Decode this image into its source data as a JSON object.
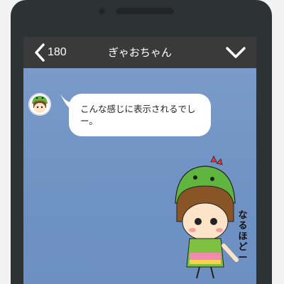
{
  "header": {
    "back_count": "180",
    "title": "ぎゃおちゃん"
  },
  "messages": [
    {
      "text": "こんな感じに表示されるでしー。"
    }
  ],
  "sticker": {
    "caption": "なるほどー"
  },
  "icons": [
    "back-chevron-icon",
    "chevron-down-icon",
    "dinosaur-avatar-icon"
  ],
  "colors": {
    "header_bg": "#3a3a3a",
    "chat_bg": "#7596c6",
    "bubble_bg": "#ffffff",
    "hood_green": "#5fb53d"
  }
}
